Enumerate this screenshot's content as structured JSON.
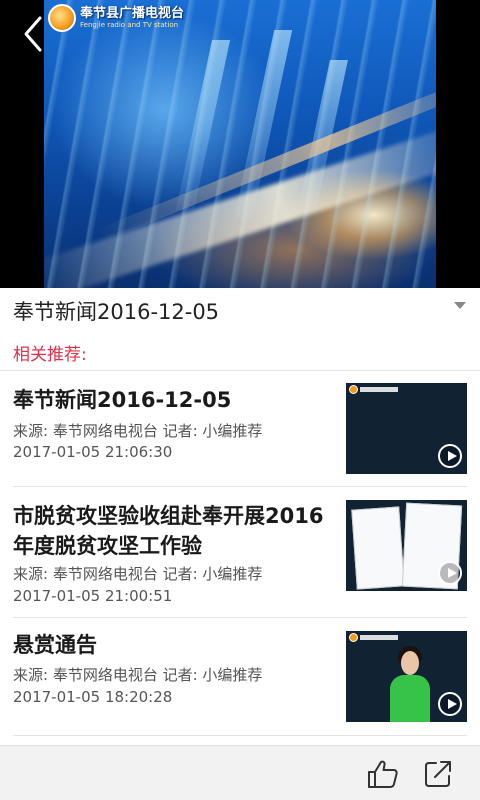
{
  "player": {
    "channel_name_cn": "奉节县广播电视台",
    "channel_name_en": "Fengjie radio and TV station"
  },
  "video": {
    "title": "奉节新闻2016-12-05"
  },
  "recommend": {
    "header": "相关推荐:"
  },
  "news": [
    {
      "title": "奉节新闻2016-12-05",
      "meta": "来源: 奉节网络电视台  记者: 小编推荐",
      "time": "2017-01-05 21:06:30",
      "thumb": "news-studio-thumbnail"
    },
    {
      "title": "市脱贫攻坚验收组赴奉开展2016年度脱贫攻坚工作验",
      "meta": "来源: 奉节网络电视台  记者: 小编推荐",
      "time": "2017-01-05 21:00:51",
      "thumb": "documents-thumbnail"
    },
    {
      "title": "悬赏通告",
      "meta": "来源: 奉节网络电视台  记者: 小编推荐",
      "time": "2017-01-05 18:20:28",
      "thumb": "news-anchor-thumbnail"
    }
  ],
  "colors": {
    "accent": "#e0304a",
    "text": "#1a1a1a",
    "meta": "#555555",
    "toolbar_bg": "#f2f2f2"
  },
  "icons": {
    "back": "chevron-left-icon",
    "expand": "caret-down-icon",
    "play": "play-circle-icon",
    "like": "thumbs-up-icon",
    "share": "share-icon"
  }
}
